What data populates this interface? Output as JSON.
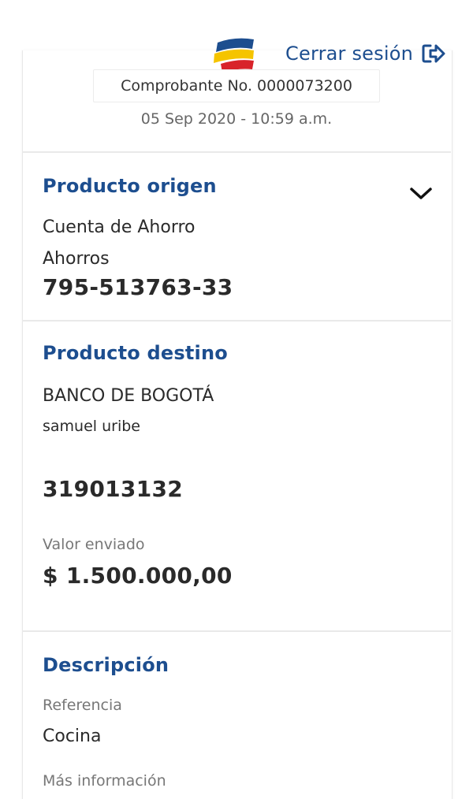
{
  "header": {
    "logout_label": "Cerrar sesión",
    "brand_colors": {
      "blue": "#1d4e8f",
      "yellow": "#f5c400",
      "red": "#d8232a"
    }
  },
  "receipt": {
    "number_text": "Comprobante No. 0000073200",
    "datetime": "05 Sep 2020 - 10:59 a.m."
  },
  "origin": {
    "title": "Producto origen",
    "account_type": "Cuenta de Ahorro",
    "subtype": "Ahorros",
    "account_number": "795-513763-33"
  },
  "destination": {
    "title": "Producto destino",
    "bank": "BANCO DE BOGOTÁ",
    "holder": "samuel uribe",
    "account_number": "319013132",
    "amount_label": "Valor enviado",
    "amount": "$ 1.500.000,00"
  },
  "description": {
    "title": "Descripción",
    "reference_label": "Referencia",
    "reference_value": "Cocina",
    "more_info_label": "Más información"
  }
}
